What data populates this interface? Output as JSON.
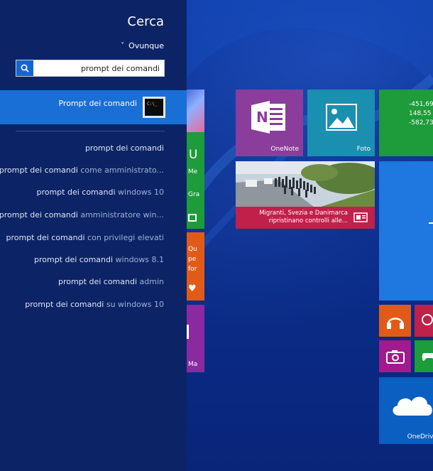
{
  "search_panel": {
    "title": "Cerca",
    "scope": "Ovunque",
    "query": "prompt dei comandi",
    "top_result": {
      "label": "Prompt dei comandi",
      "icon_text": "C:\\_"
    },
    "suggestions": [
      {
        "prefix": "prompt dei comandi",
        "suffix": ""
      },
      {
        "prefix": "prompt dei comandi",
        "suffix": " come amministrato..."
      },
      {
        "prefix": "prompt dei comandi",
        "suffix": " windows 10"
      },
      {
        "prefix": "prompt dei comandi",
        "suffix": " amministratore win..."
      },
      {
        "prefix": "prompt dei comandi",
        "suffix": " con privilegi elevati"
      },
      {
        "prefix": "prompt dei comandi",
        "suffix": " windows 8.1"
      },
      {
        "prefix": "prompt dei comandi",
        "suffix": " admin"
      },
      {
        "prefix": "prompt dei comandi",
        "suffix": " su windows 10"
      }
    ]
  },
  "tiles": {
    "onenote": {
      "label": "OneNote",
      "color": "#8a3d9a"
    },
    "foto": {
      "label": "Foto",
      "color": "#1a8fb0"
    },
    "finance": {
      "values": [
        "-451,69",
        "148,55",
        "-582,73"
      ],
      "color": "#1e9b3a"
    },
    "news": {
      "headline": "Migranti, Svezia e Danimarca ripristinano controlli alle...",
      "color": "#c0204a"
    },
    "onedrive": {
      "label": "OneDrive",
      "color": "#0a5fc0"
    },
    "music_color": "#e25a18",
    "camera_color": "#a21a8e",
    "xbox_color": "#1e9b3a",
    "video_color": "#c0204a",
    "partial_green": {
      "letter": "U",
      "lines": [
        "Me",
        "Gra"
      ],
      "color": "#1e9b3a"
    },
    "partial_orange": {
      "lines": [
        "Qu",
        "pe",
        "for"
      ],
      "color": "#e25a18"
    },
    "partial_purple": {
      "label": "Ma",
      "color": "#8a2aa0"
    }
  }
}
